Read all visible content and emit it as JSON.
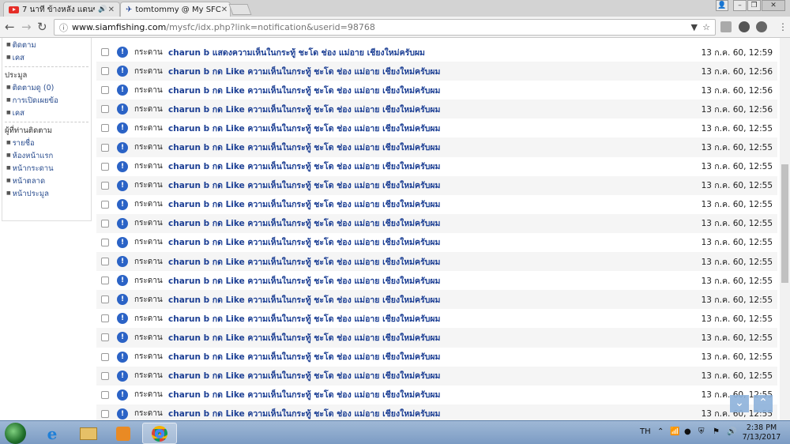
{
  "browser": {
    "tabs": [
      {
        "title": "7 นาที ข้างหลัง แดนซ์ แค",
        "audio": "speaker-icon"
      },
      {
        "title": "tomtommy @ My SFC"
      }
    ],
    "url_host": "www.siamfishing.com",
    "url_path": "/mysfc/idx.php?link=notification&userid=98768"
  },
  "sidebar": {
    "top_items": [
      "ติดตาม",
      "เคส"
    ],
    "section1": {
      "title": "ประมูล",
      "items": [
        "ติดตามดู (0)",
        "การเปิดเผยข้อ",
        "เคส"
      ]
    },
    "section2": {
      "title": "ผู้ที่ท่านติดตาม",
      "items": [
        "รายชื่อ",
        "ห้องหน้าแรก",
        "หน้ากระดาน",
        "หน้าตลาด",
        "หน้าประมูล"
      ]
    }
  },
  "notifications": [
    {
      "source": "กระดาน",
      "text": "charun b แสดงความเห็นในกระทู้ ชะโด ช่อง แม่อาย เชียงใหม่ครับผม",
      "time": "13 ก.ค. 60, 12:59"
    },
    {
      "source": "กระดาน",
      "text": "charun b กด Like ความเห็นในกระทู้ ชะโด ช่อง แม่อาย เชียงใหม่ครับผม",
      "time": "13 ก.ค. 60, 12:56"
    },
    {
      "source": "กระดาน",
      "text": "charun b กด Like ความเห็นในกระทู้ ชะโด ช่อง แม่อาย เชียงใหม่ครับผม",
      "time": "13 ก.ค. 60, 12:56"
    },
    {
      "source": "กระดาน",
      "text": "charun b กด Like ความเห็นในกระทู้ ชะโด ช่อง แม่อาย เชียงใหม่ครับผม",
      "time": "13 ก.ค. 60, 12:56"
    },
    {
      "source": "กระดาน",
      "text": "charun b กด Like ความเห็นในกระทู้ ชะโด ช่อง แม่อาย เชียงใหม่ครับผม",
      "time": "13 ก.ค. 60, 12:55"
    },
    {
      "source": "กระดาน",
      "text": "charun b กด Like ความเห็นในกระทู้ ชะโด ช่อง แม่อาย เชียงใหม่ครับผม",
      "time": "13 ก.ค. 60, 12:55"
    },
    {
      "source": "กระดาน",
      "text": "charun b กด Like ความเห็นในกระทู้ ชะโด ช่อง แม่อาย เชียงใหม่ครับผม",
      "time": "13 ก.ค. 60, 12:55"
    },
    {
      "source": "กระดาน",
      "text": "charun b กด Like ความเห็นในกระทู้ ชะโด ช่อง แม่อาย เชียงใหม่ครับผม",
      "time": "13 ก.ค. 60, 12:55"
    },
    {
      "source": "กระดาน",
      "text": "charun b กด Like ความเห็นในกระทู้ ชะโด ช่อง แม่อาย เชียงใหม่ครับผม",
      "time": "13 ก.ค. 60, 12:55"
    },
    {
      "source": "กระดาน",
      "text": "charun b กด Like ความเห็นในกระทู้ ชะโด ช่อง แม่อาย เชียงใหม่ครับผม",
      "time": "13 ก.ค. 60, 12:55"
    },
    {
      "source": "กระดาน",
      "text": "charun b กด Like ความเห็นในกระทู้ ชะโด ช่อง แม่อาย เชียงใหม่ครับผม",
      "time": "13 ก.ค. 60, 12:55"
    },
    {
      "source": "กระดาน",
      "text": "charun b กด Like ความเห็นในกระทู้ ชะโด ช่อง แม่อาย เชียงใหม่ครับผม",
      "time": "13 ก.ค. 60, 12:55"
    },
    {
      "source": "กระดาน",
      "text": "charun b กด Like ความเห็นในกระทู้ ชะโด ช่อง แม่อาย เชียงใหม่ครับผม",
      "time": "13 ก.ค. 60, 12:55"
    },
    {
      "source": "กระดาน",
      "text": "charun b กด Like ความเห็นในกระทู้ ชะโด ช่อง แม่อาย เชียงใหม่ครับผม",
      "time": "13 ก.ค. 60, 12:55"
    },
    {
      "source": "กระดาน",
      "text": "charun b กด Like ความเห็นในกระทู้ ชะโด ช่อง แม่อาย เชียงใหม่ครับผม",
      "time": "13 ก.ค. 60, 12:55"
    },
    {
      "source": "กระดาน",
      "text": "charun b กด Like ความเห็นในกระทู้ ชะโด ช่อง แม่อาย เชียงใหม่ครับผม",
      "time": "13 ก.ค. 60, 12:55"
    },
    {
      "source": "กระดาน",
      "text": "charun b กด Like ความเห็นในกระทู้ ชะโด ช่อง แม่อาย เชียงใหม่ครับผม",
      "time": "13 ก.ค. 60, 12:55"
    },
    {
      "source": "กระดาน",
      "text": "charun b กด Like ความเห็นในกระทู้ ชะโด ช่อง แม่อาย เชียงใหม่ครับผม",
      "time": "13 ก.ค. 60, 12:55"
    },
    {
      "source": "กระดาน",
      "text": "charun b กด Like ความเห็นในกระทู้ ชะโด ช่อง แม่อาย เชียงใหม่ครับผม",
      "time": "13 ก.ค. 60, 12:55"
    },
    {
      "source": "กระดาน",
      "text": "charun b กด Like ความเห็นในกระทู้ ชะโด ช่อง แม่อาย เชียงใหม่ครับผม",
      "time": "13 ก.ค. 60, 12:55"
    }
  ],
  "taskbar": {
    "language": "TH",
    "time": "2:38 PM",
    "date": "7/13/2017"
  },
  "colors": {
    "link": "#1c3f94",
    "bell": "#2b63c6",
    "row_alt": "#f5f5f5"
  }
}
